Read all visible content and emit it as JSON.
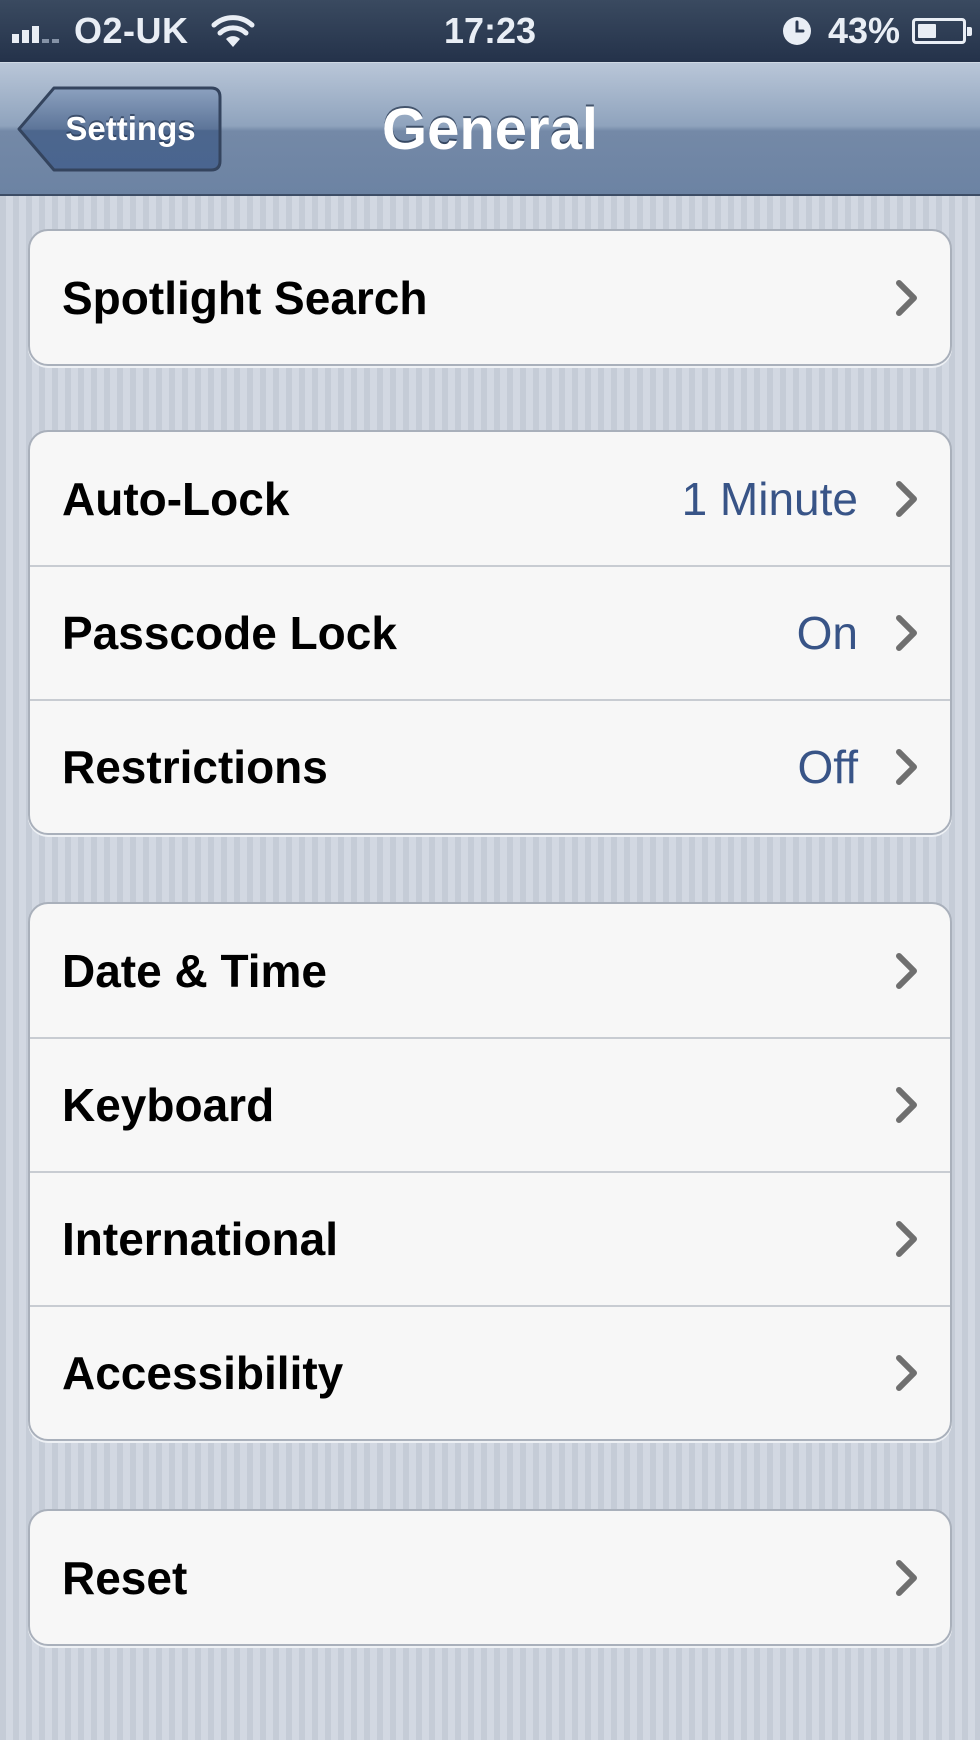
{
  "status_bar": {
    "carrier": "O2-UK",
    "time": "17:23",
    "battery_percent": "43%",
    "battery_level": 0.43,
    "signal_bars": 3,
    "icons": [
      "signal-icon",
      "wifi-icon",
      "clock-icon",
      "battery-icon"
    ]
  },
  "nav": {
    "back_label": "Settings",
    "title": "General"
  },
  "groups": [
    {
      "rows": [
        {
          "label": "Spotlight Search",
          "value": ""
        }
      ]
    },
    {
      "rows": [
        {
          "label": "Auto-Lock",
          "value": "1 Minute"
        },
        {
          "label": "Passcode Lock",
          "value": "On"
        },
        {
          "label": "Restrictions",
          "value": "Off"
        }
      ]
    },
    {
      "rows": [
        {
          "label": "Date & Time",
          "value": ""
        },
        {
          "label": "Keyboard",
          "value": ""
        },
        {
          "label": "International",
          "value": ""
        },
        {
          "label": "Accessibility",
          "value": ""
        }
      ]
    },
    {
      "rows": [
        {
          "label": "Reset",
          "value": ""
        }
      ]
    }
  ],
  "colors": {
    "value_text": "#385487",
    "nav_bar": "#6c83a3",
    "status_bar": "#24324a"
  }
}
